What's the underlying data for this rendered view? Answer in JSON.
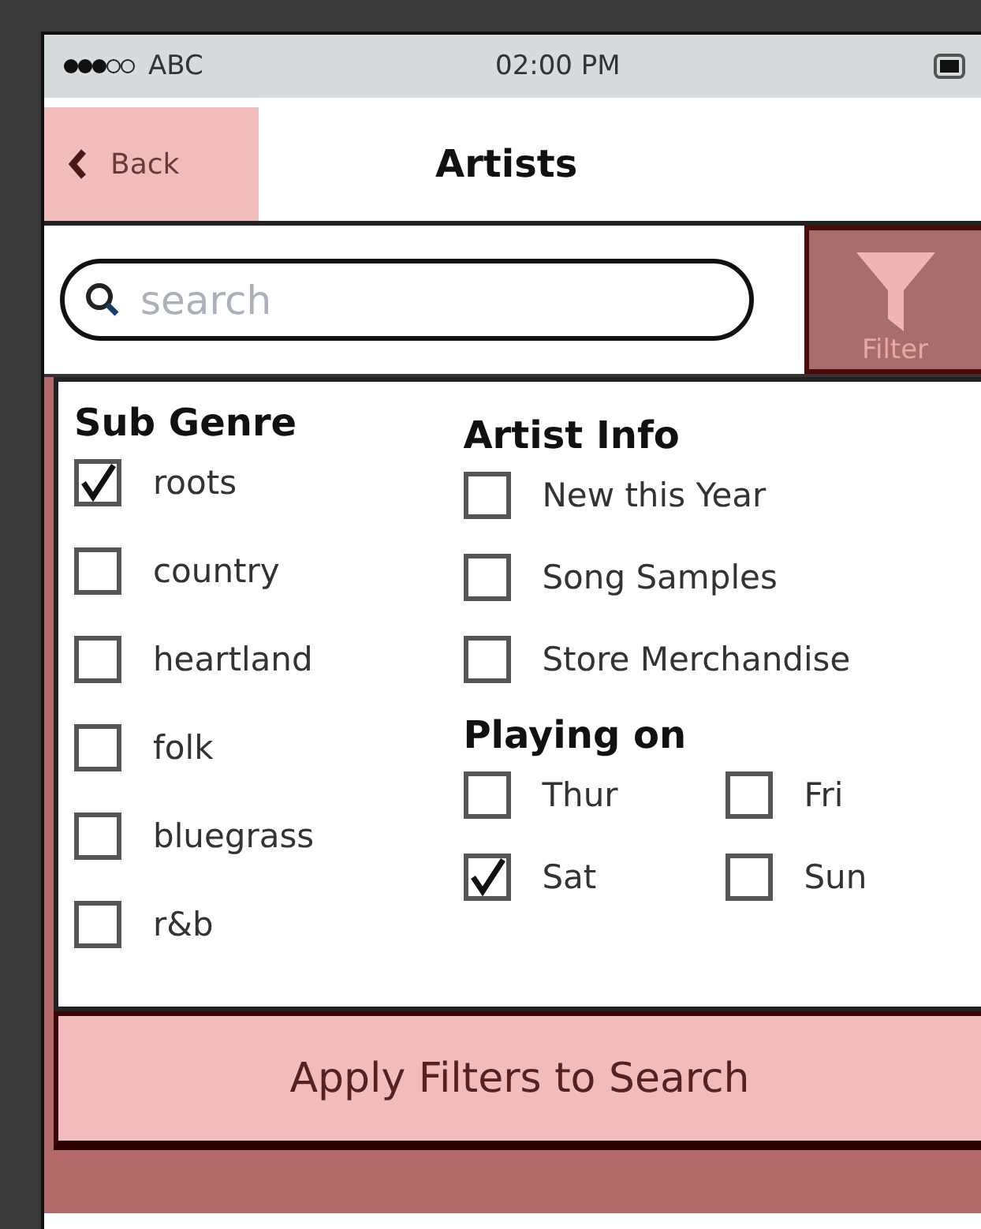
{
  "status_bar": {
    "carrier": "ABC",
    "time": "02:00 PM"
  },
  "nav": {
    "back": "Back",
    "title": "Artists"
  },
  "search": {
    "placeholder": "search"
  },
  "filter_button": {
    "label": "Filter"
  },
  "groups": [
    {
      "title": "Sub Genre",
      "options": [
        {
          "label": "roots",
          "checked": true
        },
        {
          "label": "country",
          "checked": false
        },
        {
          "label": "heartland",
          "checked": false
        },
        {
          "label": "folk",
          "checked": false
        },
        {
          "label": "bluegrass",
          "checked": false
        },
        {
          "label": "r&b",
          "checked": false
        }
      ]
    },
    {
      "title": "Artist Info",
      "options": [
        {
          "label": "New this Year",
          "checked": false
        },
        {
          "label": "Song Samples",
          "checked": false
        },
        {
          "label": "Store Merchandise",
          "checked": false
        }
      ]
    },
    {
      "title": "Playing on",
      "options": [
        {
          "label": "Thur",
          "checked": false
        },
        {
          "label": "Fri",
          "checked": false
        },
        {
          "label": "Sat",
          "checked": true
        },
        {
          "label": "Sun",
          "checked": false
        }
      ]
    }
  ],
  "apply_button": "Apply Filters to Search"
}
